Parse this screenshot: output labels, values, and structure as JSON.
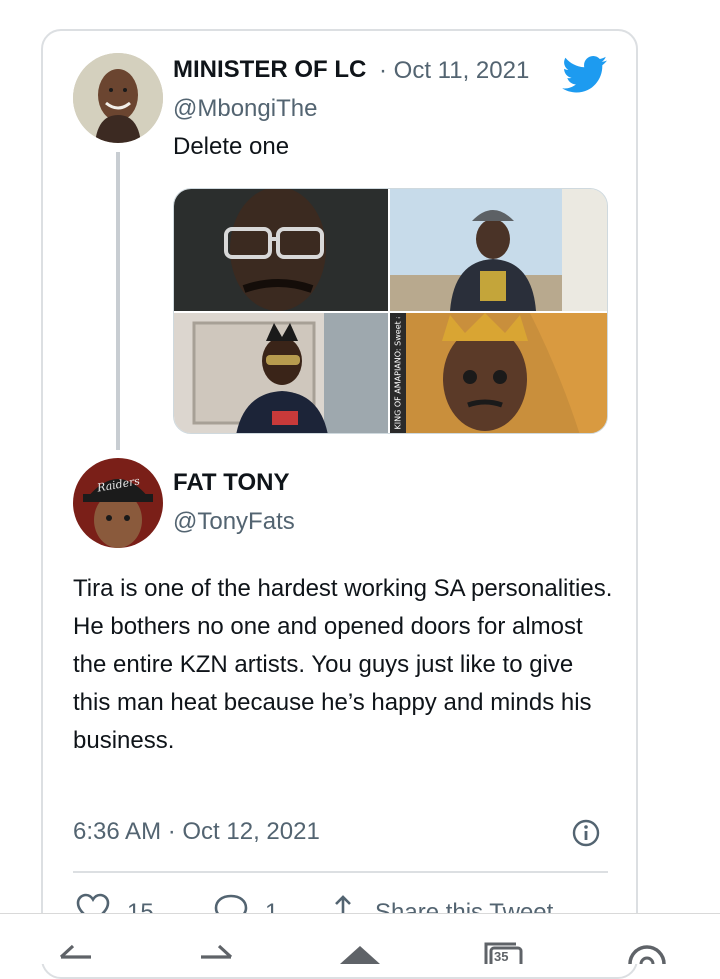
{
  "tweet_quoted": {
    "author_name": "MINISTER OF LC",
    "date": "· Oct 11, 2021",
    "handle": "@MbongiThe",
    "text": "Delete one",
    "photo_watermark": "KING OF AMAPIANO: Sweet and Dust"
  },
  "tweet_main": {
    "author_name": "FAT TONY",
    "handle": "@TonyFats",
    "avatar_cap_text": "Raiders",
    "text": "Tira is one of the hardest working SA personalities. He bothers no one and opened doors for almost the entire KZN artists. You guys just like to give this man heat because he’s happy and minds his business.",
    "timestamp": "6:36 AM · Oct 12, 2021"
  },
  "actions": {
    "likes": "15",
    "replies": "1",
    "share_label": "Share this Tweet"
  },
  "browser_nav": {
    "tab_count": "35"
  },
  "colors": {
    "twitter_blue": "#1d9bf0",
    "secondary_text": "#536471",
    "primary_text": "#0f1419",
    "border": "#dcdfe2"
  },
  "icons": [
    "twitter-bird-icon",
    "info-icon",
    "heart-icon",
    "reply-icon",
    "share-icon",
    "back-arrow-icon",
    "forward-arrow-icon",
    "home-icon",
    "tabs-icon",
    "search-icon"
  ]
}
